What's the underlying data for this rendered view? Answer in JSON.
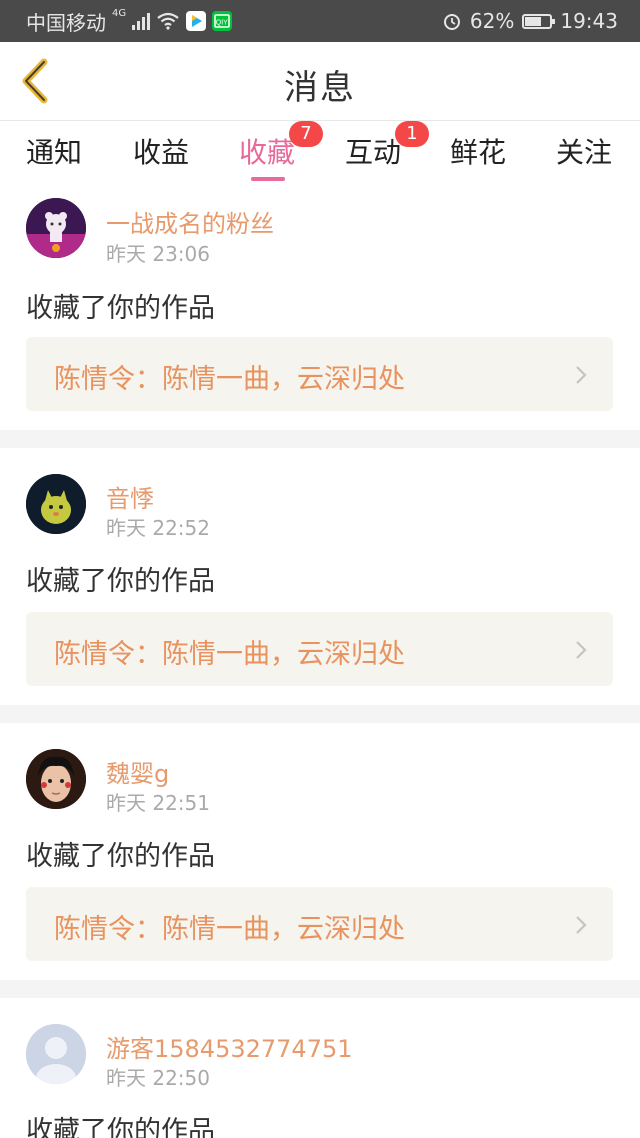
{
  "status_bar": {
    "carrier": "中国移动",
    "network": "4G",
    "battery": "62%",
    "time": "19:43",
    "icons": [
      "signal-icon",
      "wifi-icon",
      "video-app-icon",
      "iqiyi-app-icon",
      "alarm-icon",
      "battery-icon"
    ]
  },
  "header": {
    "title": "消息",
    "back_icon": "chevron-left-icon"
  },
  "tabs": [
    {
      "label": "通知"
    },
    {
      "label": "收益"
    },
    {
      "label": "收藏",
      "badge": "7",
      "active": true
    },
    {
      "label": "互动",
      "badge": "1"
    },
    {
      "label": "鲜花"
    },
    {
      "label": "关注"
    }
  ],
  "colors": {
    "accent_pink": "#e76a9b",
    "username": "#e79a6c",
    "work_text": "#e8935f",
    "badge": "#f44747",
    "card_bg": "#f5f4ee"
  },
  "messages": [
    {
      "user": "一战成名的粉丝",
      "time": "昨天 23:06",
      "action": "收藏了你的作品",
      "work": "陈情令：陈情一曲，云深归处"
    },
    {
      "user": "音悸",
      "time": "昨天 22:52",
      "action": "收藏了你的作品",
      "work": "陈情令：陈情一曲，云深归处"
    },
    {
      "user": "魏婴g",
      "time": "昨天 22:51",
      "action": "收藏了你的作品",
      "work": "陈情令：陈情一曲，云深归处"
    },
    {
      "user": "游客1584532774751",
      "time": "昨天 22:50",
      "action": "收藏了你的作品"
    }
  ]
}
